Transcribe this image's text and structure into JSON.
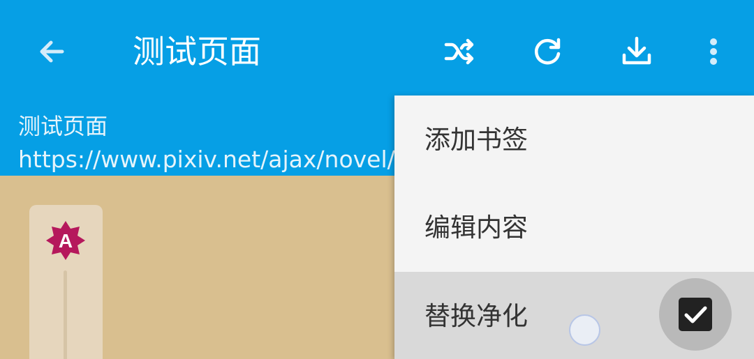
{
  "appbar": {
    "title": "测试页面",
    "color": "#069fe5",
    "icons": [
      "back-arrow-icon",
      "shuffle-icon",
      "refresh-icon",
      "download-icon",
      "more-vert-icon"
    ]
  },
  "subheader": {
    "title": "测试页面",
    "url": "https://www.pixiv.net/ajax/novel/"
  },
  "font_panel": {
    "badge_letter": "A",
    "badge_color": "#b5185c"
  },
  "menu": {
    "items": [
      {
        "label": "添加书签"
      },
      {
        "label": "编辑内容"
      },
      {
        "label": "替换净化",
        "checked": true
      }
    ]
  }
}
